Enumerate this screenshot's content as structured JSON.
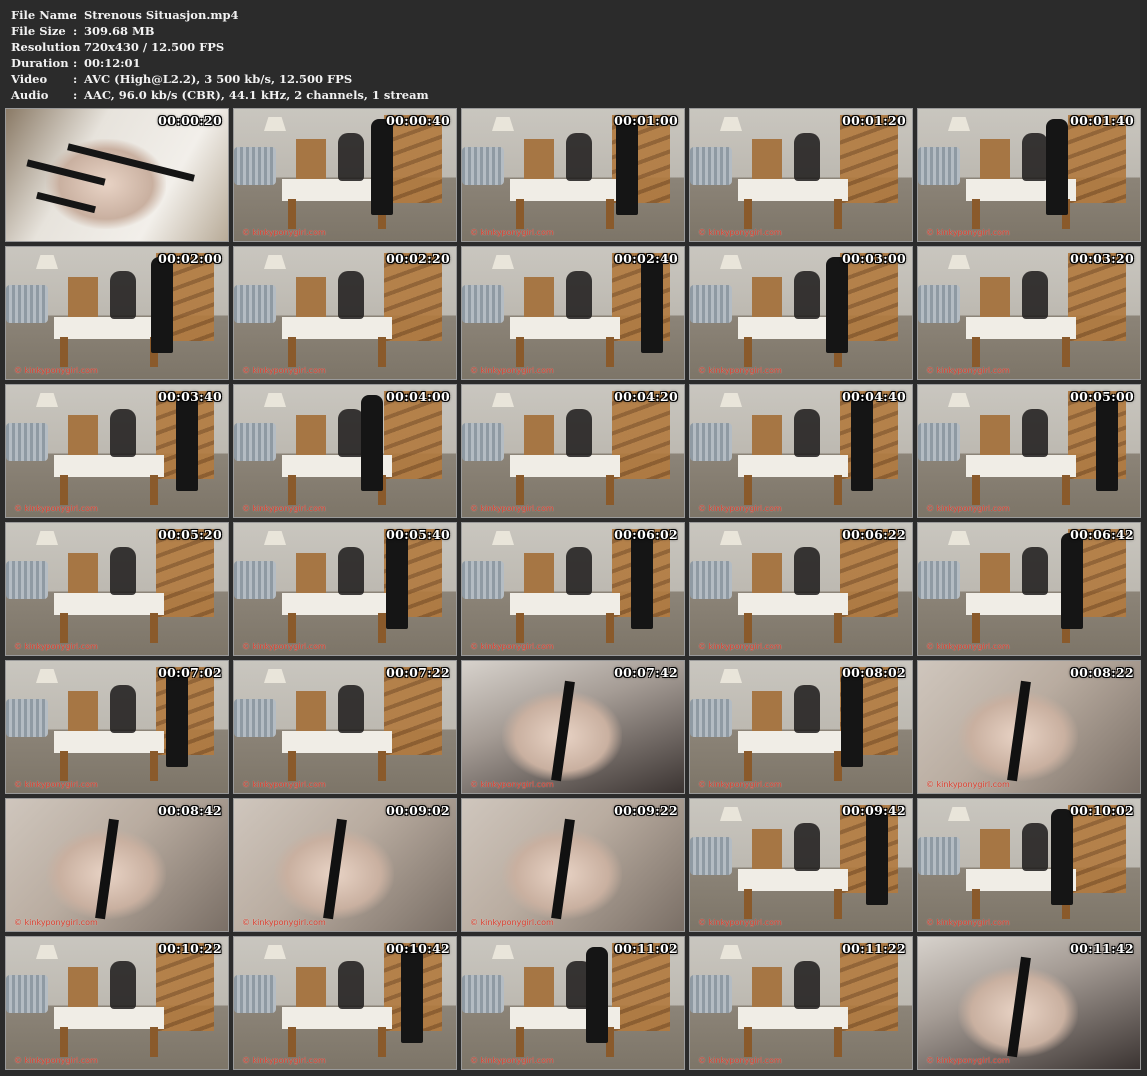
{
  "info": {
    "rows": [
      {
        "label": "File Name",
        "value": "Strenous Situasjon.mp4"
      },
      {
        "label": "File Size",
        "value": "309.68 MB"
      },
      {
        "label": "Resolution",
        "value": "720x430 / 12.500 FPS"
      },
      {
        "label": "Duration",
        "value": "00:12:01"
      },
      {
        "label": "Video",
        "value": "AVC (High@L2.2), 3 500 kb/s, 12.500 FPS"
      },
      {
        "label": "Audio",
        "value": "AAC, 96.0 kb/s (CBR), 44.1 kHz, 2 channels, 1 stream"
      }
    ],
    "separator": ":"
  },
  "watermark": "© kinkyponygirl.com",
  "thumbnails": [
    {
      "time": "00:00:20",
      "scene": "fur"
    },
    {
      "time": "00:00:40",
      "scene": "room"
    },
    {
      "time": "00:01:00",
      "scene": "room"
    },
    {
      "time": "00:01:20",
      "scene": "room"
    },
    {
      "time": "00:01:40",
      "scene": "room"
    },
    {
      "time": "00:02:00",
      "scene": "room"
    },
    {
      "time": "00:02:20",
      "scene": "room"
    },
    {
      "time": "00:02:40",
      "scene": "room"
    },
    {
      "time": "00:03:00",
      "scene": "room"
    },
    {
      "time": "00:03:20",
      "scene": "room"
    },
    {
      "time": "00:03:40",
      "scene": "room"
    },
    {
      "time": "00:04:00",
      "scene": "room"
    },
    {
      "time": "00:04:20",
      "scene": "room"
    },
    {
      "time": "00:04:40",
      "scene": "room"
    },
    {
      "time": "00:05:00",
      "scene": "room"
    },
    {
      "time": "00:05:20",
      "scene": "room"
    },
    {
      "time": "00:05:40",
      "scene": "room"
    },
    {
      "time": "00:06:02",
      "scene": "room"
    },
    {
      "time": "00:06:22",
      "scene": "room"
    },
    {
      "time": "00:06:42",
      "scene": "room"
    },
    {
      "time": "00:07:02",
      "scene": "room"
    },
    {
      "time": "00:07:22",
      "scene": "room"
    },
    {
      "time": "00:07:42",
      "scene": "dark-closeup"
    },
    {
      "time": "00:08:02",
      "scene": "room"
    },
    {
      "time": "00:08:22",
      "scene": "closeup"
    },
    {
      "time": "00:08:42",
      "scene": "closeup"
    },
    {
      "time": "00:09:02",
      "scene": "closeup"
    },
    {
      "time": "00:09:22",
      "scene": "closeup"
    },
    {
      "time": "00:09:42",
      "scene": "room"
    },
    {
      "time": "00:10:02",
      "scene": "room"
    },
    {
      "time": "00:10:22",
      "scene": "room"
    },
    {
      "time": "00:10:42",
      "scene": "room"
    },
    {
      "time": "00:11:02",
      "scene": "room"
    },
    {
      "time": "00:11:22",
      "scene": "room"
    },
    {
      "time": "00:11:42",
      "scene": "dark-closeup"
    }
  ]
}
